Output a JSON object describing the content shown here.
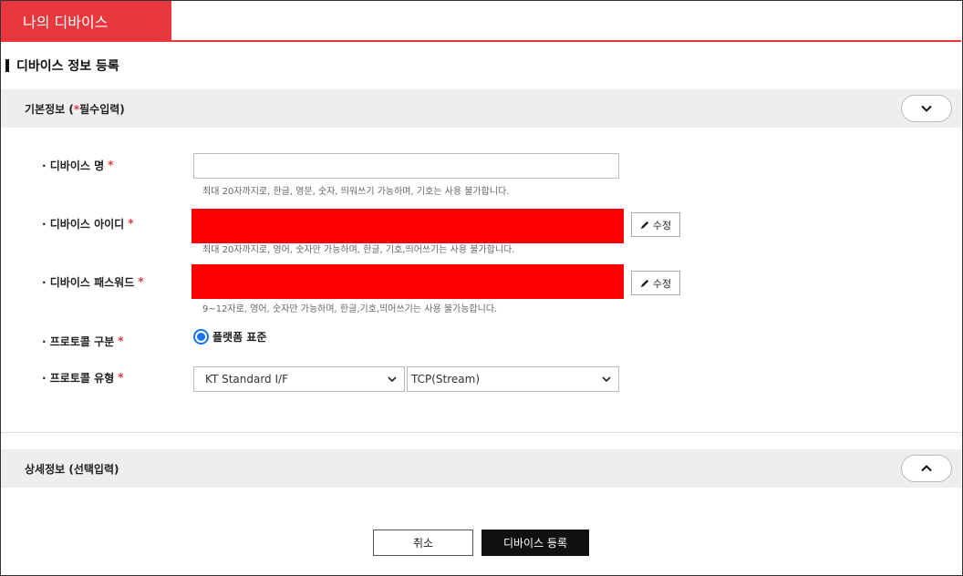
{
  "tab": {
    "label": "나의 디바이스"
  },
  "section": {
    "title": "디바이스 정보 등록"
  },
  "basic_panel": {
    "title_prefix": "기본정보 (",
    "req_mark": "*",
    "title_suffix": "필수입력)"
  },
  "fields": {
    "name": {
      "label": "· 디바이스 명",
      "star": "*",
      "value": "",
      "hint": "최대 20자까지로, 한글, 영문, 숫자, 띄워쓰기 가능하며, 기호는 사용 불가합니다."
    },
    "id": {
      "label": "· 디바이스 아이디",
      "star": "*",
      "hint": "최대 20자까지로, 영어, 숫자만 가능하며, 한글, 기호,띄어쓰기는 사용 불가합니다.",
      "edit_label": "수정"
    },
    "password": {
      "label": "· 디바이스 패스워드",
      "star": "*",
      "hint": "9~12자로, 영어, 숫자만 가능하며, 한글,기호,띄어쓰기는 사용 불가능합니다.",
      "edit_label": "수정"
    },
    "protocol_kind": {
      "label": "· 프로토콜 구분",
      "star": "*",
      "option": "플랫폼 표준"
    },
    "protocol_type": {
      "label": "· 프로토콜 유형",
      "star": "*",
      "select1": "KT Standard I/F",
      "select2": "TCP(Stream)"
    }
  },
  "detail_panel": {
    "title": "상세정보 (선택입력)"
  },
  "actions": {
    "cancel": "취소",
    "submit": "디바이스 등록"
  },
  "colors": {
    "accent": "#e8383d",
    "radio": "#1a73e8"
  }
}
